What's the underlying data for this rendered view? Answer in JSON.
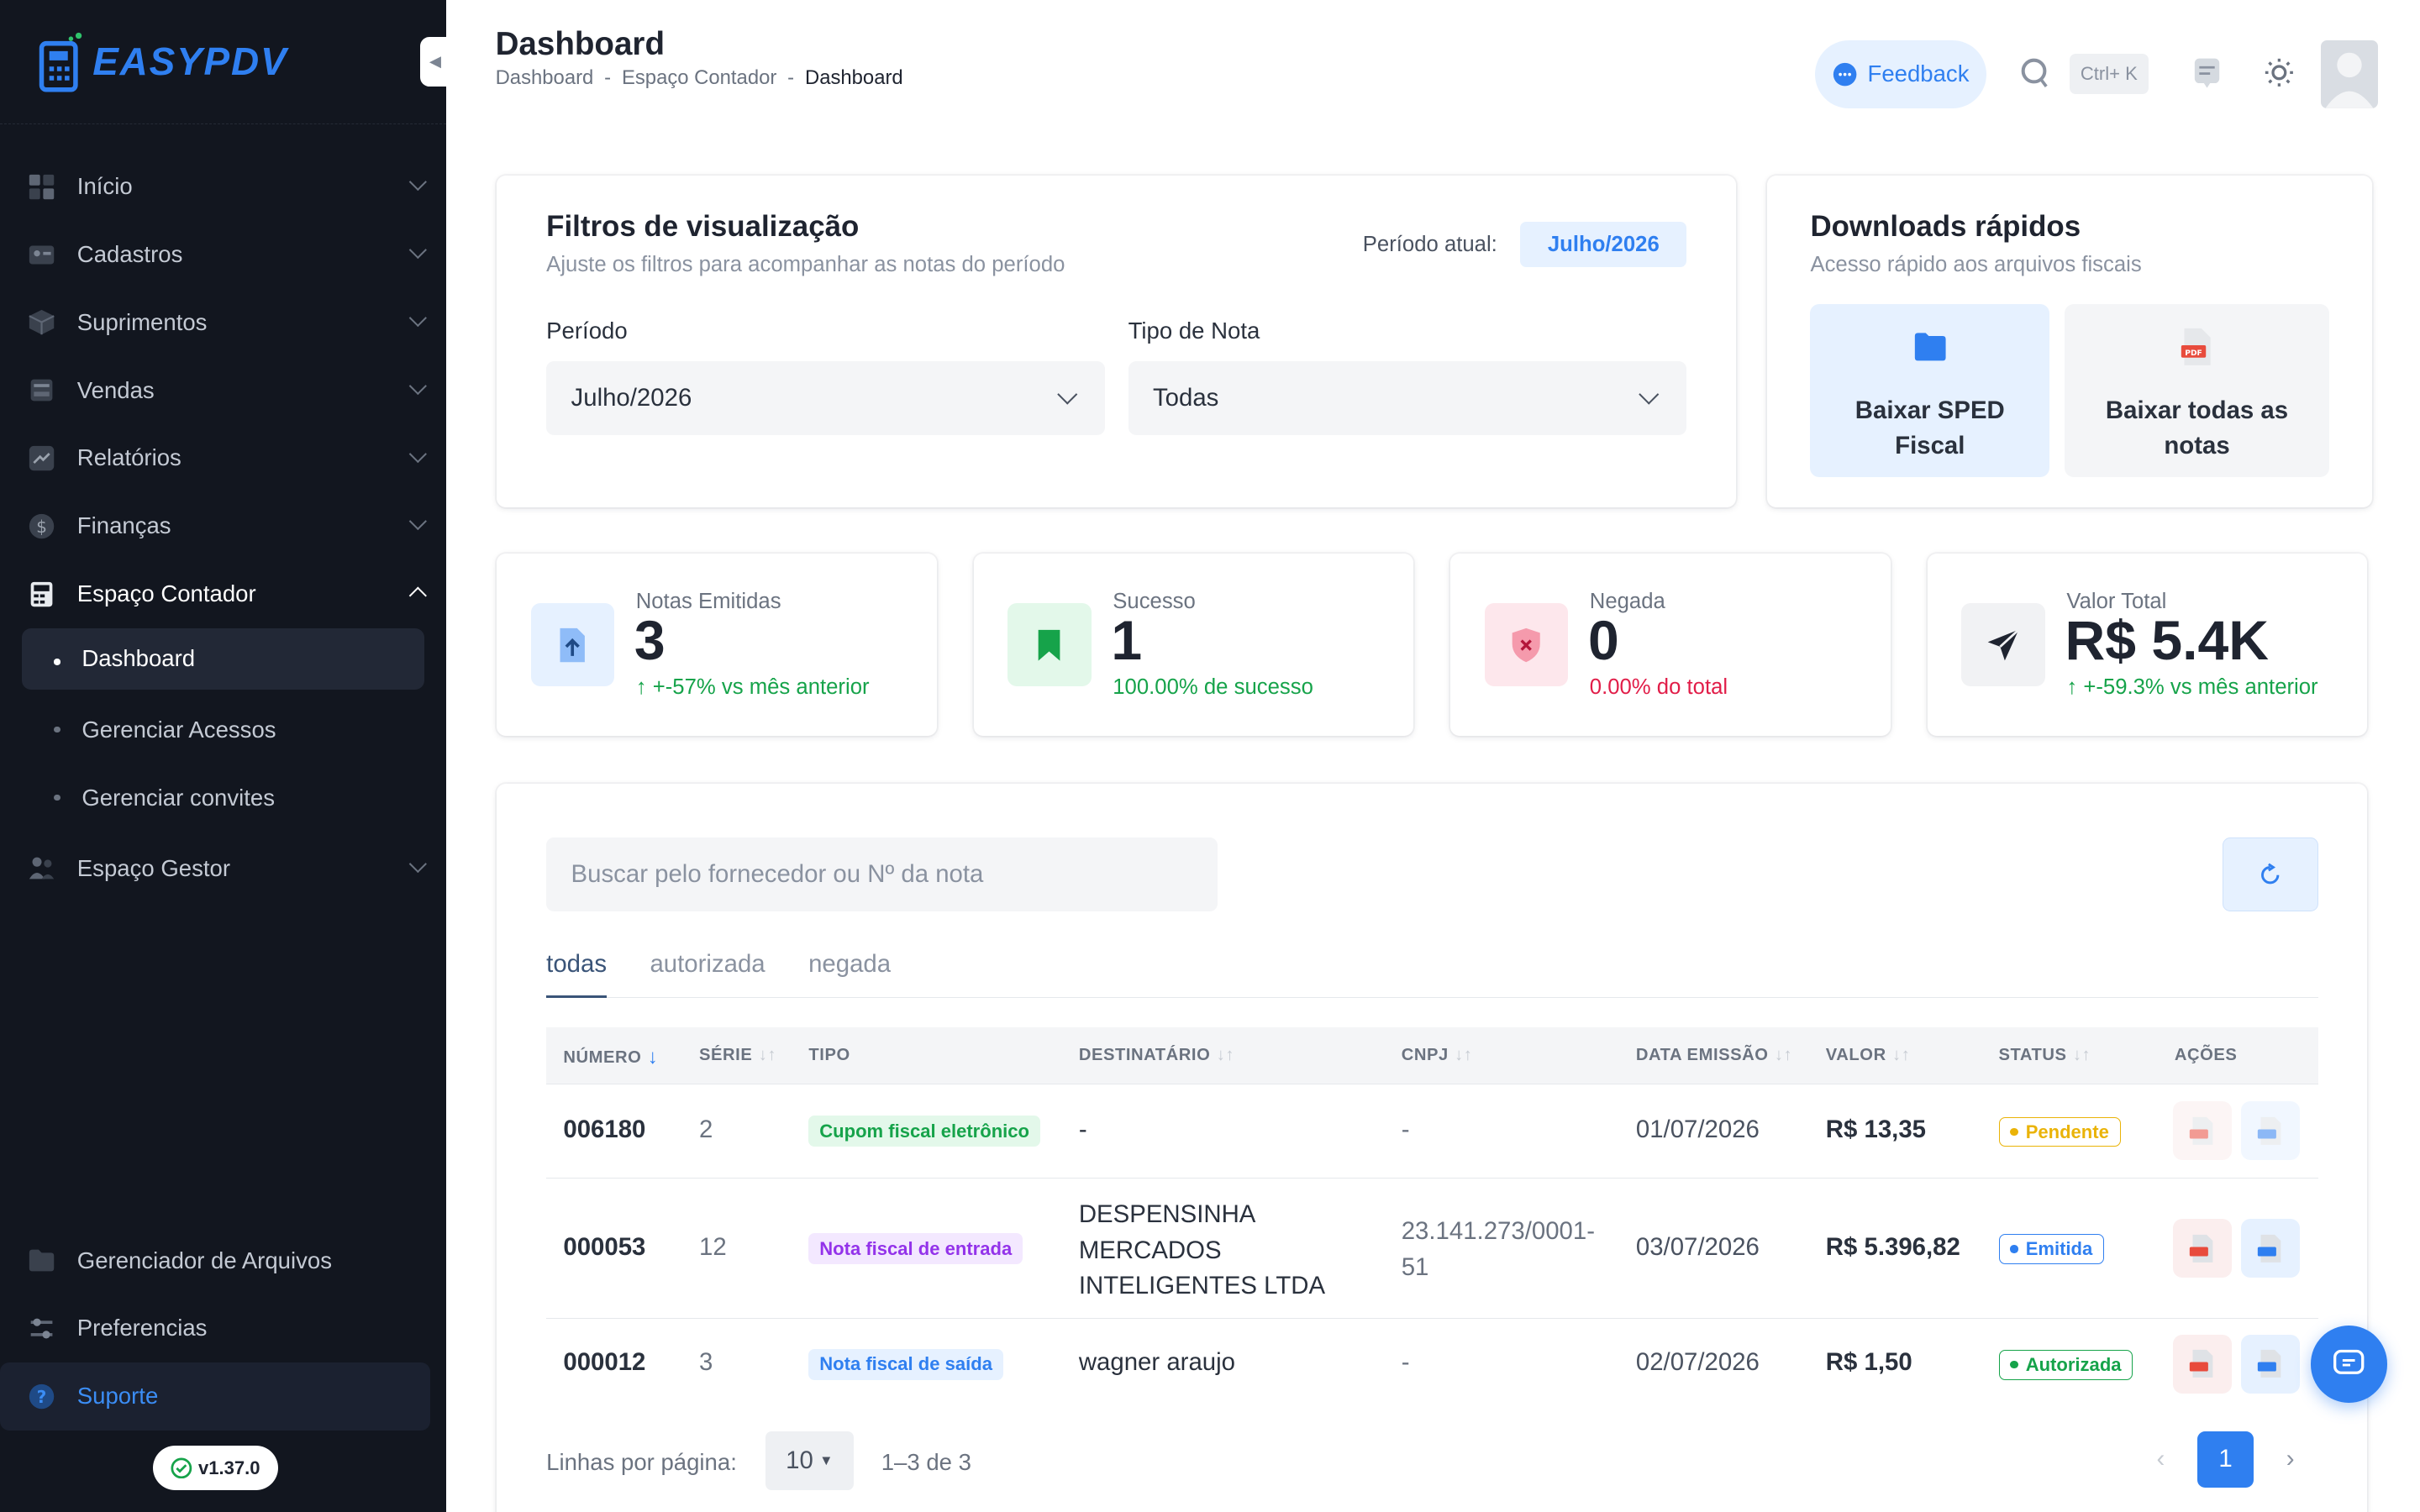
{
  "brand": {
    "logo_text": "EASYPDV"
  },
  "sidebar": {
    "items": [
      {
        "label": "Início",
        "icon": "home-grid-icon"
      },
      {
        "label": "Cadastros",
        "icon": "id-card-icon"
      },
      {
        "label": "Suprimentos",
        "icon": "box-icon"
      },
      {
        "label": "Vendas",
        "icon": "register-icon"
      },
      {
        "label": "Relatórios",
        "icon": "chart-line-icon"
      },
      {
        "label": "Finanças",
        "icon": "dollar-icon"
      },
      {
        "label": "Espaço Contador",
        "icon": "calculator-icon"
      }
    ],
    "sub_items": [
      "Dashboard",
      "Gerenciar Acessos",
      "Gerenciar convites"
    ],
    "gestor": {
      "label": "Espaço Gestor"
    },
    "bottom": [
      "Gerenciador de Arquivos",
      "Preferencias",
      "Suporte"
    ],
    "version": "v1.37.0"
  },
  "header": {
    "title": "Dashboard",
    "breadcrumb": [
      "Dashboard",
      "-",
      "Espaço Contador",
      "-",
      "Dashboard"
    ],
    "feedback": "Feedback",
    "shortcut": "Ctrl+ K"
  },
  "filters": {
    "title": "Filtros de visualização",
    "subtitle": "Ajuste os filtros para acompanhar as notas do período",
    "current_period_label": "Período atual:",
    "current_period": "Julho/2026",
    "period_label": "Período",
    "period_value": "Julho/2026",
    "type_label": "Tipo de Nota",
    "type_value": "Todas"
  },
  "downloads": {
    "title": "Downloads rápidos",
    "subtitle": "Acesso rápido aos arquivos fiscais",
    "sped_line1": "Baixar SPED",
    "sped_line2": "Fiscal",
    "all_line1": "Baixar todas as",
    "all_line2": "notas"
  },
  "stats": [
    {
      "label": "Notas Emitidas",
      "value": "3",
      "detail": "+-57% vs mês anterior",
      "color": "#16a34a"
    },
    {
      "label": "Sucesso",
      "value": "1",
      "detail": "100.00% de sucesso",
      "color": "#16a34a"
    },
    {
      "label": "Negada",
      "value": "0",
      "detail": "0.00% do total",
      "color": "#e11d48"
    },
    {
      "label": "Valor Total",
      "value": "R$ 5.4K",
      "detail": "+-59.3% vs mês anterior",
      "color": "#16a34a"
    }
  ],
  "table": {
    "search_placeholder": "Buscar pelo fornecedor ou Nº da nota",
    "tabs": [
      "todas",
      "autorizada",
      "negada"
    ],
    "columns": [
      "NÚMERO",
      "SÉRIE",
      "TIPO",
      "DESTINATÁRIO",
      "CNPJ",
      "DATA EMISSÃO",
      "VALOR",
      "STATUS",
      "AÇÕES"
    ],
    "rows": [
      {
        "numero": "006180",
        "serie": "2",
        "tipo": "Cupom fiscal eletrônico",
        "dest1": "-",
        "dest2": "",
        "dest3": "",
        "cnpj1": "-",
        "cnpj2": "",
        "data": "01/07/2026",
        "valor": "R$ 13,35",
        "status": "Pendente"
      },
      {
        "numero": "000053",
        "serie": "12",
        "tipo": "Nota fiscal de entrada",
        "dest1": "DESPENSINHA",
        "dest2": "MERCADOS",
        "dest3": "INTELIGENTES LTDA",
        "cnpj1": "23.141.273/0001-",
        "cnpj2": "51",
        "data": "03/07/2026",
        "valor": "R$ 5.396,82",
        "status": "Emitida"
      },
      {
        "numero": "000012",
        "serie": "3",
        "tipo": "Nota fiscal de saída",
        "dest1": "wagner araujo",
        "dest2": "",
        "dest3": "",
        "cnpj1": "-",
        "cnpj2": "",
        "data": "02/07/2026",
        "valor": "R$ 1,50",
        "status": "Autorizada"
      }
    ],
    "rows_per_page_label": "Linhas por página:",
    "rows_per_page": "10",
    "range": "1–3 de 3",
    "page": "1"
  },
  "colors": {
    "accent": "#2f7ff0",
    "sidebar_bg": "#12161f",
    "pending": "#eab308",
    "emitted": "#2f7ff0",
    "authorized": "#16a34a"
  }
}
